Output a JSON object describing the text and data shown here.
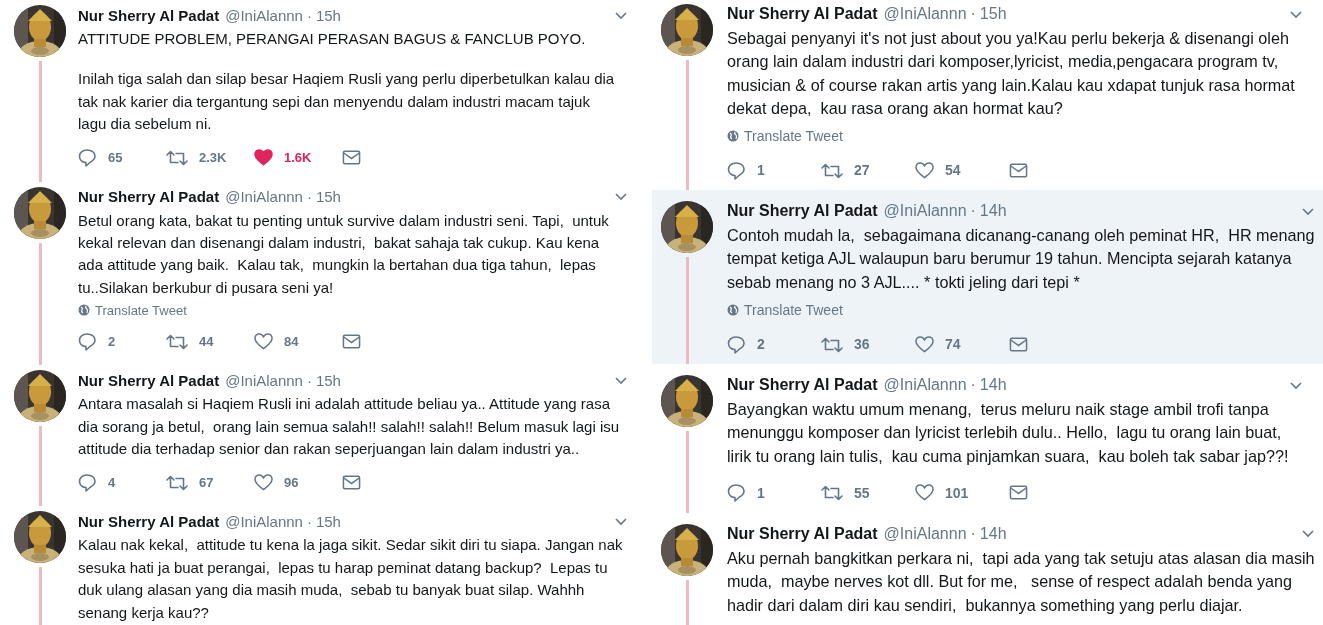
{
  "separator": "·",
  "columns": [
    {
      "tweets": [
        {
          "name": "Nur Sherry Al Padat",
          "handle": "@IniAlannn",
          "time": "15h",
          "highlighted": false,
          "paragraphs": [
            "ATTITUDE PROBLEM, PERANGAI PERASAN BAGUS & FANCLUB POYO.",
            "Inilah tiga salah dan silap besar Haqiem Rusli yang perlu diperbetulkan kalau dia\ntak nak karier dia tergantung sepi dan menyendu dalam industri macam tajuk\nlagu dia sebelum ni."
          ],
          "actions": {
            "replies": "65",
            "retweets": "2.3K",
            "likes": "1.6K",
            "liked": true
          }
        },
        {
          "name": "Nur Sherry Al Padat",
          "handle": "@IniAlannn",
          "time": "15h",
          "highlighted": false,
          "paragraphs": [
            "Betul orang kata, bakat tu penting untuk survive dalam industri seni. Tapi,  untuk\nkekal relevan dan disenangi dalam industri,  bakat sahaja tak cukup. Kau kena\nada attitude yang baik.  Kalau tak,  mungkin la bertahan dua tiga tahun,  lepas\ntu..Silakan berkubur di pusara seni ya!"
          ],
          "translate": "Translate Tweet",
          "actions": {
            "replies": "2",
            "retweets": "44",
            "likes": "84",
            "liked": false
          }
        },
        {
          "name": "Nur Sherry Al Padat",
          "handle": "@IniAlannn",
          "time": "15h",
          "highlighted": false,
          "paragraphs": [
            "Antara masalah si Haqiem Rusli ini adalah attitude beliau ya.. Attitude yang rasa\ndia sorang ja betul,  orang lain semua salah!! salah!! salah!! Belum masuk lagi isu\nattitude dia terhadap senior dan rakan seperjuangan lain dalam industri ya.."
          ],
          "actions": {
            "replies": "4",
            "retweets": "67",
            "likes": "96",
            "liked": false
          }
        },
        {
          "name": "Nur Sherry Al Padat",
          "handle": "@IniAlannn",
          "time": "15h",
          "highlighted": false,
          "paragraphs": [
            "Kalau nak kekal,  attitude tu kena la jaga sikit. Sedar sikit diri tu siapa. Jangan nak\nsesuka hati ja buat perangai,  lepas tu harap peminat datang backup?  Lepas tu\nduk ulang alasan yang dia masih muda,  sebab tu banyak buat silap. Wahhh\nsenang kerja kau??"
          ]
        }
      ]
    },
    {
      "tweets": [
        {
          "name": "Nur Sherry Al Padat",
          "handle": "@IniAlannn",
          "time": "15h",
          "highlighted": false,
          "paragraphs": [
            "Sebagai penyanyi it's not just about you ya!Kau perlu bekerja & disenangi oleh\norang lain dalam industri dari komposer,lyricist, media,pengacara program tv,\nmusician & of course rakan artis yang lain.Kalau kau xdapat tunjuk rasa hormat\ndekat depa,  kau rasa orang akan hormat kau?"
          ],
          "translate": "Translate Tweet",
          "actions": {
            "replies": "1",
            "retweets": "27",
            "likes": "54",
            "liked": false
          }
        },
        {
          "name": "Nur Sherry Al Padat",
          "handle": "@IniAlannn",
          "time": "14h",
          "highlighted": true,
          "paragraphs": [
            "Contoh mudah la,  sebagaimana dicanang-canang oleh peminat HR,  HR menang\ntempat ketiga AJL walaupun baru berumur 19 tahun. Mencipta sejarah katanya\nsebab menang no 3 AJL.... * tokti jeling dari tepi *"
          ],
          "translate": "Translate Tweet",
          "actions": {
            "replies": "2",
            "retweets": "36",
            "likes": "74",
            "liked": false
          }
        },
        {
          "name": "Nur Sherry Al Padat",
          "handle": "@IniAlannn",
          "time": "14h",
          "highlighted": false,
          "paragraphs": [
            "Bayangkan waktu umum menang,  terus meluru naik stage ambil trofi tanpa\nmenunggu komposer dan lyricist terlebih dulu.. Hello,  lagu tu orang lain buat,\nlirik tu orang lain tulis,  kau cuma pinjamkan suara,  kau boleh tak sabar jap??!"
          ],
          "actions": {
            "replies": "1",
            "retweets": "55",
            "likes": "101",
            "liked": false
          }
        },
        {
          "name": "Nur Sherry Al Padat",
          "handle": "@IniAlannn",
          "time": "14h",
          "highlighted": false,
          "paragraphs": [
            "Aku pernah bangkitkan perkara ni,  tapi ada yang tak setuju atas alasan dia masih\nmuda,  maybe nerves kot dll. But for me,   sense of respect adalah benda yang\nhadir dari dalam diri kau sendiri,  bukannya something yang perlu diajar."
          ]
        }
      ]
    }
  ]
}
